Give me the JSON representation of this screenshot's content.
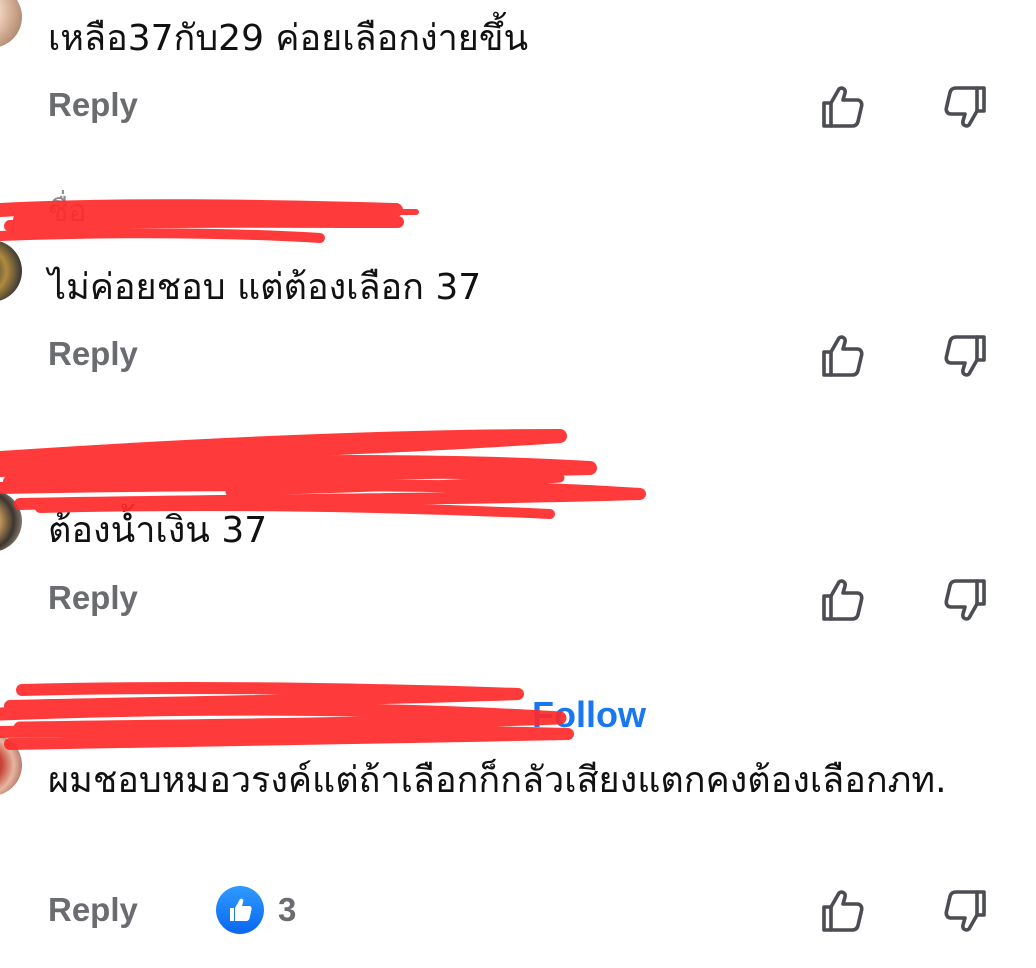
{
  "labels": {
    "reply": "Reply"
  },
  "comments": [
    {
      "text": "เหลือ37กับ29 ค่อยเลือกง่ายขึ้น"
    },
    {
      "text": "ไม่ค่อยชอบ แต่ต้องเลือก 37"
    },
    {
      "text": "ต้องน้ำเงิน 37"
    },
    {
      "follow_label": "Follow",
      "text": "ผมชอบหมอวรงค์แต่ถ้าเลือกก็กลัวเสียงแตกคงต้องเลือกภท.",
      "reaction_count": "3"
    }
  ],
  "icons": {
    "like": "thumbs-up-outline-icon",
    "dislike": "thumbs-down-outline-icon",
    "reaction": "like-reaction-icon"
  },
  "colors": {
    "text": "#111111",
    "muted": "#6a6c70",
    "link": "#1877f2",
    "redaction": "#ff2a2a"
  }
}
